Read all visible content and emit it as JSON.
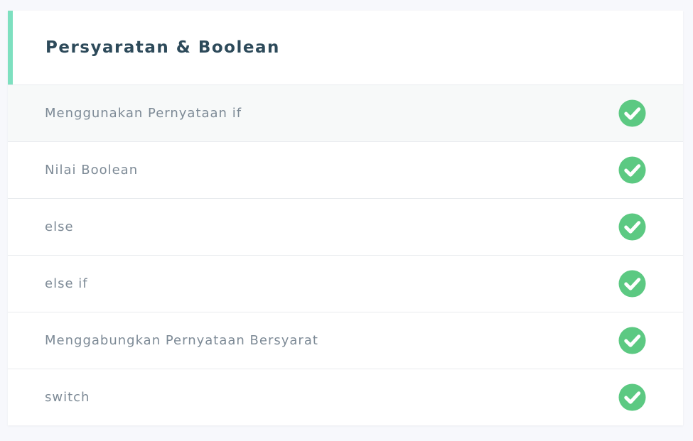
{
  "section": {
    "title": "Persyaratan & Boolean",
    "accent_color": "#7ee0c0",
    "check_color": "#5cc982",
    "items": [
      {
        "label": "Menggunakan Pernyataan if",
        "completed": true,
        "active": true
      },
      {
        "label": "Nilai Boolean",
        "completed": true,
        "active": false
      },
      {
        "label": "else",
        "completed": true,
        "active": false
      },
      {
        "label": "else if",
        "completed": true,
        "active": false
      },
      {
        "label": "Menggabungkan Pernyataan Bersyarat",
        "completed": true,
        "active": false
      },
      {
        "label": "switch",
        "completed": true,
        "active": false
      }
    ]
  }
}
